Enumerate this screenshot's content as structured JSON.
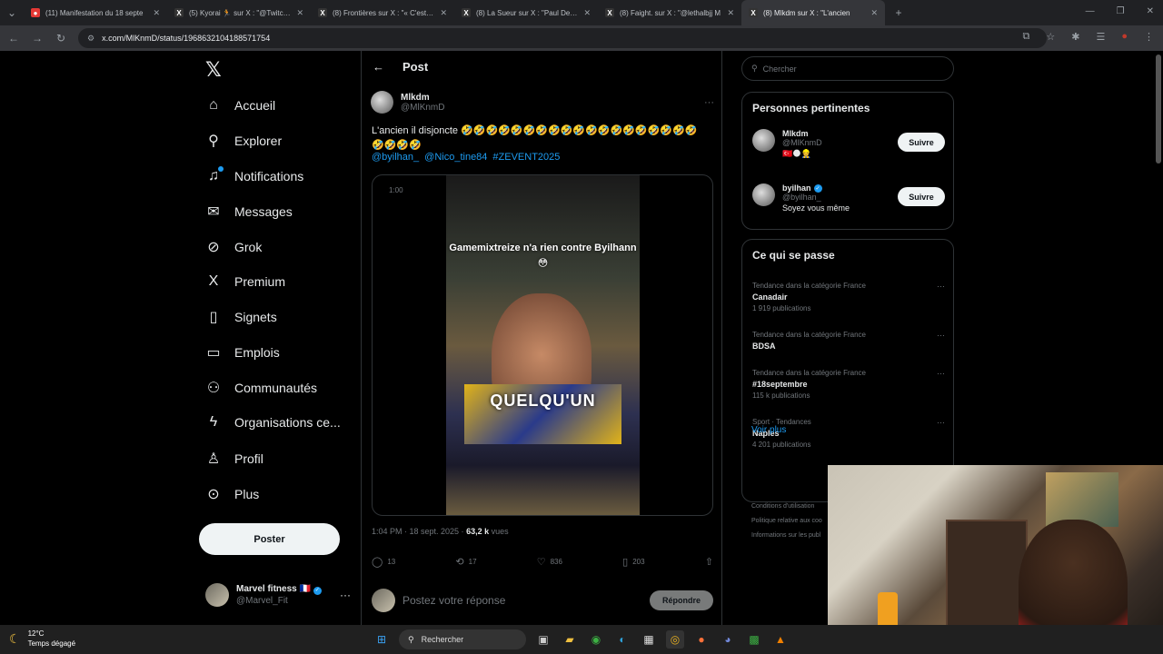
{
  "browser": {
    "tabs": [
      {
        "title": "(11) Manifestation du 18 septe",
        "fav_color": "#e53935",
        "fav_glyph": "●",
        "active": false
      },
      {
        "title": "(5) Kyorai 🏃 sur X : \"@TwitchB",
        "fav_color": "#333333",
        "fav_glyph": "X",
        "active": false
      },
      {
        "title": "(8) Frontières sur X : \"« C'est pa",
        "fav_color": "#333333",
        "fav_glyph": "X",
        "active": false
      },
      {
        "title": "(8) La Sueur sur X : \"Paul Denis",
        "fav_color": "#333333",
        "fav_glyph": "X",
        "active": false
      },
      {
        "title": "(8) Faight. sur X : \"@lethalbjj M",
        "fav_color": "#333333",
        "fav_glyph": "X",
        "active": false
      },
      {
        "title": "(8) Mlkdm sur X : \"L'ancien",
        "fav_color": "#333333",
        "fav_glyph": "X",
        "active": true
      }
    ],
    "url": "x.com/MlKnmD/status/1968632104188571754"
  },
  "nav": {
    "items": [
      {
        "label": "Accueil",
        "icon": "home-icon",
        "glyph": "⌂"
      },
      {
        "label": "Explorer",
        "icon": "search-icon",
        "glyph": "⚲"
      },
      {
        "label": "Notifications",
        "icon": "bell-icon",
        "glyph": "♫"
      },
      {
        "label": "Messages",
        "icon": "mail-icon",
        "glyph": "✉"
      },
      {
        "label": "Grok",
        "icon": "grok-icon",
        "glyph": "⊘"
      },
      {
        "label": "Premium",
        "icon": "x-logo-icon",
        "glyph": "X"
      },
      {
        "label": "Signets",
        "icon": "bookmark-icon",
        "glyph": "▯"
      },
      {
        "label": "Emplois",
        "icon": "briefcase-icon",
        "glyph": "▭"
      },
      {
        "label": "Communautés",
        "icon": "community-icon",
        "glyph": "⚇"
      },
      {
        "label": "Organisations ce...",
        "icon": "lightning-icon",
        "glyph": "ϟ"
      },
      {
        "label": "Profil",
        "icon": "person-icon",
        "glyph": "♙"
      },
      {
        "label": "Plus",
        "icon": "more-circle-icon",
        "glyph": "⊙"
      }
    ],
    "post_label": "Poster",
    "account": {
      "name": "Marvel fitness 🇫🇷",
      "handle": "@Marvel_Fit"
    }
  },
  "main": {
    "header_title": "Post",
    "author": {
      "name": "Mlkdm",
      "handle": "@MlKnmD"
    },
    "text": "L'ancien il disjoncte 🤣🤣🤣🤣🤣🤣🤣🤣🤣🤣🤣🤣🤣🤣🤣🤣🤣🤣🤣🤣🤣🤣🤣",
    "links": [
      "@byilhan_",
      "@Nico_tine84",
      "#ZEVENT2025"
    ],
    "video_time": "1:00",
    "video_caption": "Gamemixtreize n'a rien contre Byilhann 😳",
    "video_word": "QUELQU'UN",
    "meta_time": "1:04 PM · 18 sept. 2025 · ",
    "meta_views": "63,2 k",
    "meta_views_label": " vues",
    "actions": {
      "replies": "13",
      "reposts": "17",
      "likes": "836",
      "bookmarks": "203"
    },
    "reply_placeholder": "Postez votre réponse",
    "reply_button": "Répondre"
  },
  "right": {
    "search_placeholder": "Chercher",
    "relevant_title": "Personnes pertinentes",
    "people": [
      {
        "name": "Mlkdm",
        "handle": "@MlKnmD",
        "bio": "🇹🇷🌑👷",
        "button": "Suivre",
        "verified": false
      },
      {
        "name": "byilhan",
        "handle": "@byilhan_",
        "bio": "Soyez vous même",
        "button": "Suivre",
        "verified": true
      }
    ],
    "trends_title": "Ce qui se passe",
    "trends": [
      {
        "cat": "Tendance dans la catégorie France",
        "name": "Canadair",
        "count": "1 919 publications"
      },
      {
        "cat": "Tendance dans la catégorie France",
        "name": "BDSA",
        "count": ""
      },
      {
        "cat": "Tendance dans la catégorie France",
        "name": "#18septembre",
        "count": "115 k publications"
      },
      {
        "cat": "Sport · Tendances",
        "name": "Naples",
        "count": "4 201 publications"
      }
    ],
    "show_more": "Voir plus",
    "footer": [
      "Conditions d'utilisation",
      "Politique relative aux coo",
      "Informations sur les publ"
    ]
  },
  "taskbar": {
    "temp": "12°C",
    "weather": "Temps dégagé",
    "search": "Rechercher"
  }
}
